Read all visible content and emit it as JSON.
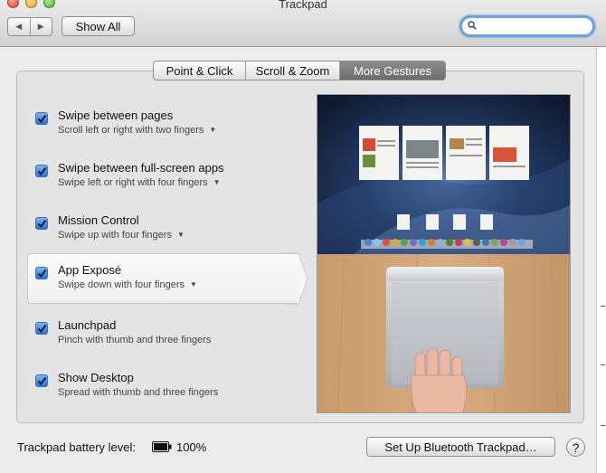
{
  "window": {
    "title": "Trackpad"
  },
  "toolbar": {
    "back_glyph": "◀",
    "forward_glyph": "▶",
    "show_all_label": "Show All",
    "search_value": "",
    "search_placeholder": ""
  },
  "tabs": [
    {
      "label": "Point & Click",
      "active": false
    },
    {
      "label": "Scroll & Zoom",
      "active": false
    },
    {
      "label": "More Gestures",
      "active": true
    }
  ],
  "gestures": [
    {
      "title": "Swipe between pages",
      "subtitle": "Scroll left or right with two fingers",
      "has_dropdown": true,
      "checked": true,
      "selected": false
    },
    {
      "title": "Swipe between full-screen apps",
      "subtitle": "Swipe left or right with four fingers",
      "has_dropdown": true,
      "checked": true,
      "selected": false
    },
    {
      "title": "Mission Control",
      "subtitle": "Swipe up with four fingers",
      "has_dropdown": true,
      "checked": true,
      "selected": false
    },
    {
      "title": "App Exposé",
      "subtitle": "Swipe down with four fingers",
      "has_dropdown": true,
      "checked": true,
      "selected": true
    },
    {
      "title": "Launchpad",
      "subtitle": "Pinch with thumb and three fingers",
      "has_dropdown": false,
      "checked": true,
      "selected": false
    },
    {
      "title": "Show Desktop",
      "subtitle": "Spread with thumb and three fingers",
      "has_dropdown": false,
      "checked": true,
      "selected": false
    }
  ],
  "dropdown_glyph": "▼",
  "footer": {
    "battery_label": "Trackpad battery level:",
    "battery_value": "100%",
    "bluetooth_button": "Set Up Bluetooth Trackpad…",
    "help_label": "?"
  },
  "colors": {
    "accent": "#2f6fd1",
    "active_tab": "#7b7b7b"
  }
}
